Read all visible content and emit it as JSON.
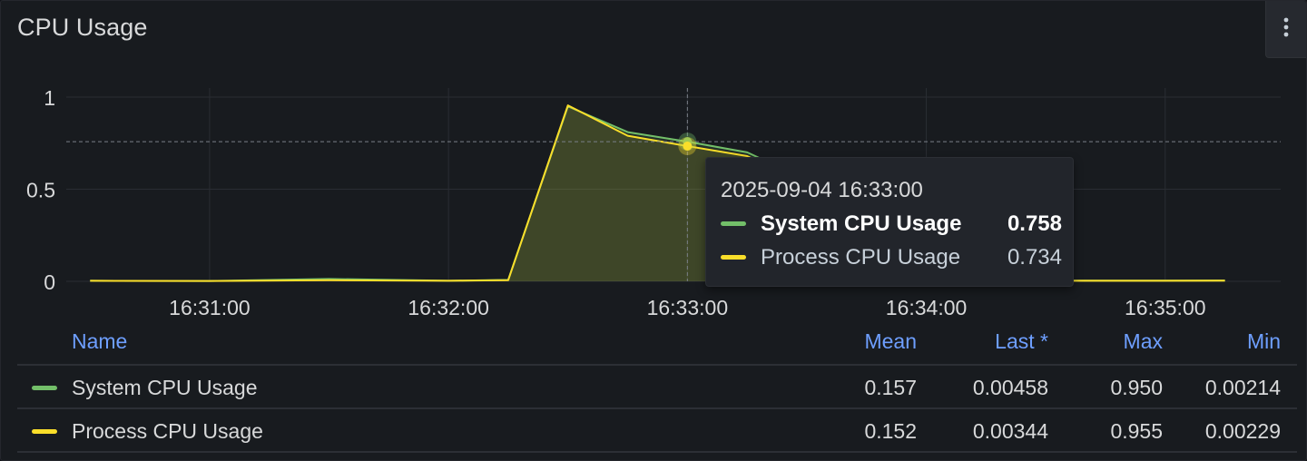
{
  "panel": {
    "title": "CPU Usage",
    "menu_icon": "kebab-vertical-icon"
  },
  "colors": {
    "system": "#73bf69",
    "process": "#fade2a",
    "grid": "#2a2d33",
    "axis_text": "#d8d9da"
  },
  "chart_data": {
    "type": "area",
    "x_tick_labels": [
      "16:31:00",
      "16:32:00",
      "16:33:00",
      "16:34:00",
      "16:35:00"
    ],
    "y_tick_labels": [
      "0",
      "0.5",
      "1"
    ],
    "ylim": [
      0,
      1
    ],
    "xlim": [
      "16:30:24",
      "16:35:29"
    ],
    "grid": true,
    "hover_time": "16:33:00",
    "series": [
      {
        "name": "System CPU Usage",
        "color": "#73bf69",
        "x": [
          "16:30:30",
          "16:31:00",
          "16:31:30",
          "16:32:00",
          "16:32:15",
          "16:32:30",
          "16:32:45",
          "16:33:00",
          "16:33:15",
          "16:33:30",
          "16:33:45",
          "16:34:00",
          "16:34:15",
          "16:34:30",
          "16:34:45",
          "16:35:00",
          "16:35:15"
        ],
        "values": [
          0.003,
          0.002,
          0.013,
          0.003,
          0.008,
          0.95,
          0.81,
          0.758,
          0.7,
          0.55,
          0.25,
          0.05,
          0.005,
          0.004,
          0.004,
          0.004,
          0.00458
        ]
      },
      {
        "name": "Process CPU Usage",
        "color": "#fade2a",
        "x": [
          "16:30:30",
          "16:31:00",
          "16:31:30",
          "16:32:00",
          "16:32:15",
          "16:32:30",
          "16:32:45",
          "16:33:00",
          "16:33:15",
          "16:33:30",
          "16:33:45",
          "16:34:00",
          "16:34:15",
          "16:34:30",
          "16:34:45",
          "16:35:00",
          "16:35:15"
        ],
        "values": [
          0.003,
          0.002,
          0.006,
          0.003,
          0.006,
          0.955,
          0.79,
          0.734,
          0.68,
          0.53,
          0.24,
          0.05,
          0.004,
          0.003,
          0.003,
          0.003,
          0.00344
        ]
      }
    ]
  },
  "tooltip": {
    "time": "2025-09-04 16:33:00",
    "rows": [
      {
        "name": "System CPU Usage",
        "value": "0.758"
      },
      {
        "name": "Process CPU Usage",
        "value": "0.734"
      }
    ]
  },
  "legend": {
    "headers": {
      "name": "Name",
      "mean": "Mean",
      "last": "Last *",
      "max": "Max",
      "min": "Min"
    },
    "rows": [
      {
        "name": "System CPU Usage",
        "mean": "0.157",
        "last": "0.00458",
        "max": "0.950",
        "min": "0.00214"
      },
      {
        "name": "Process CPU Usage",
        "mean": "0.152",
        "last": "0.00344",
        "max": "0.955",
        "min": "0.00229"
      }
    ]
  }
}
